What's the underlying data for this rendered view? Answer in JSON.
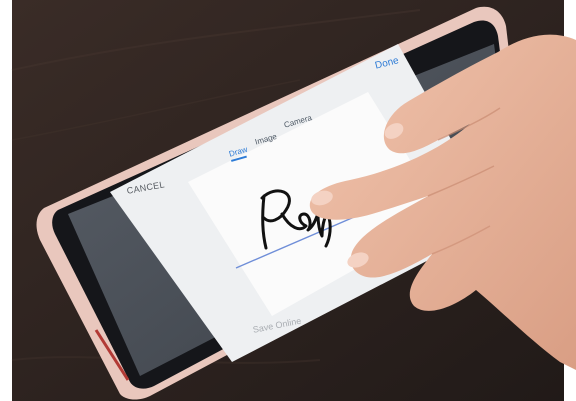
{
  "screen": {
    "cancel_label": "CANCEL",
    "tabs": [
      {
        "label": "Draw",
        "selected": true
      },
      {
        "label": "Image",
        "selected": false
      },
      {
        "label": "Camera",
        "selected": false
      }
    ],
    "done_label": "Done",
    "save_online_label": "Save Online"
  },
  "colors": {
    "accent": "#2d7bd6",
    "table": "#2a211e",
    "phone_case": "#e9c7bd",
    "skin": "#e8b49c"
  }
}
